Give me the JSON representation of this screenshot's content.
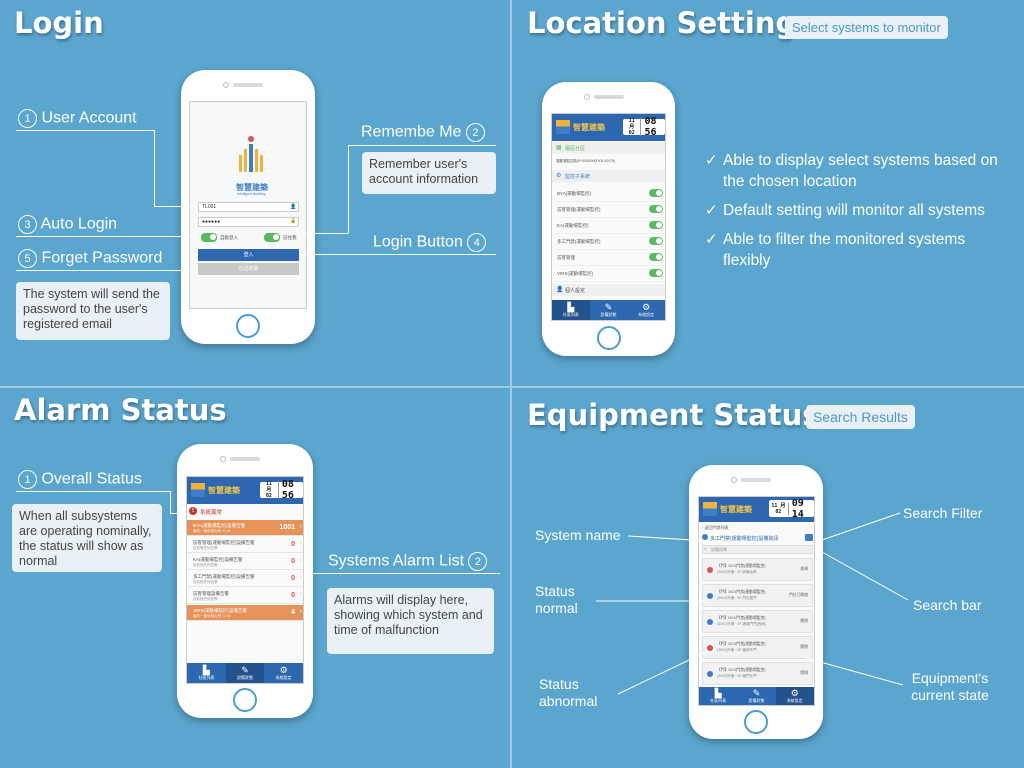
{
  "sections": {
    "login": {
      "title": "Login"
    },
    "location": {
      "title": "Location Settings",
      "tag": "Select systems to monitor"
    },
    "alarm": {
      "title": "Alarm Status"
    },
    "equipment": {
      "title": "Equipment Status",
      "tag": "Search Results"
    }
  },
  "login": {
    "callouts": {
      "user_account": {
        "num": "1",
        "label": "User Account"
      },
      "remember_me": {
        "num": "2",
        "label": "Remembe Me",
        "desc": "Remember user's account information"
      },
      "auto_login": {
        "num": "3",
        "label": "Auto Login"
      },
      "login_button": {
        "num": "4",
        "label": "Login Button"
      },
      "forget_password": {
        "num": "5",
        "label": "Forget Password",
        "desc": "The system will send the password to the user's registered email"
      }
    },
    "screen": {
      "logo_text": "智慧建築",
      "logo_sub": "Intelligent Building",
      "account_value": "TL001",
      "password_value": "●●●●●●",
      "auto_login_label": "自動登入",
      "remember_label": "記住我",
      "login_btn": "登入",
      "forget_btn": "忘記密碼"
    }
  },
  "location": {
    "bullets": [
      "Able to display select systems based on the chosen location",
      "Default setting will monitor all systems",
      "Able to filter the monitored systems flexibly"
    ],
    "screen": {
      "app_name": "智慧建築",
      "date": "11 月 02",
      "time": "08 56",
      "section1": "園區社區",
      "section1_row": "運動場監控區(FH00000000YB-00075)",
      "section2": "監控子系統",
      "systems": [
        "BYA(運動場監控)",
        "訪客管理(運動場監控)",
        "KA(運動場監控)",
        "多工門禁(運動場監控)",
        "訪客管理",
        "VIRS(運動場監控)"
      ],
      "section3": "個人設定",
      "tabs": [
        "社區列表",
        "設備狀態",
        "系統設定"
      ]
    }
  },
  "alarm": {
    "callouts": {
      "overall": {
        "num": "1",
        "label": "Overall Status",
        "desc": "When all subsystems are operating nominally, the status will show as normal"
      },
      "list": {
        "num": "2",
        "label": "Systems Alarm List",
        "desc": "Alarms will display here, showing which system and time of malfunction"
      }
    },
    "screen": {
      "app_name": "智慧建築",
      "date": "11 月 02",
      "time": "08 56",
      "status_text": "系統異常",
      "rows": [
        {
          "name": "BYA(運動場監控)設備告警",
          "sub": "最新一筆設備告警 11:46",
          "count": "1001"
        },
        {
          "name": "訪客管理(運動場監控)設備告警",
          "sub": "目前無任何告警",
          "count": "0"
        },
        {
          "name": "KA(運動場監控)設備告警",
          "sub": "目前無任何告警",
          "count": "0"
        },
        {
          "name": "多工門禁(運動場監控)設備告警",
          "sub": "目前無任何告警",
          "count": "0"
        },
        {
          "name": "訪客管理設備告警",
          "sub": "目前無任何告警",
          "count": "0"
        },
        {
          "name": "VIRS(運動場監控)設備告警",
          "sub": "最新一筆設備告警 11:44",
          "count": "4"
        }
      ],
      "tabs": [
        "社區列表",
        "設備狀態",
        "系統設定"
      ]
    }
  },
  "equipment": {
    "callouts": {
      "system_name": "System name",
      "status_normal": "Status normal",
      "status_abnormal": "Status abnormal",
      "search_filter": "Search Filter",
      "search_bar": "Search bar",
      "current_state": "Equipment's current state"
    },
    "screen": {
      "app_name": "智慧建築",
      "date": "11 月 02",
      "time": "09 14",
      "back": "‹ 返回門禁列表",
      "system": "多工門禁(運動場監控)設備資訊",
      "search_placeholder": "設備搜尋",
      "items": [
        {
          "line1": "【門】DCV門禁(運動場監控)",
          "line2": "(3002)外棟 · 0F-設備倉庫",
          "state": "故障",
          "color": "#d9534f"
        },
        {
          "line1": "【門】DCV門禁(運動場監控)",
          "line2": "(3003)外棟 · 0F-門位置門",
          "state": "門位已開啟",
          "color": "#3c7fc7"
        },
        {
          "line1": "【門】DCV門禁(運動場監控)",
          "line2": "(3001)外棟 · 0F-通道門門(西側)",
          "state": "關閉",
          "color": "#3c7fc7"
        },
        {
          "line1": "【門】DCV門禁(運動場監控)",
          "line2": "(3004)外棟 · 0F-機房外門",
          "state": "關閉",
          "color": "#d9534f"
        },
        {
          "line1": "【門】DCV門禁(運動場監控)",
          "line2": "(3005)外棟 · 0F-機門外門",
          "state": "關閉",
          "color": "#3c7fc7"
        }
      ],
      "tabs": [
        "社區列表",
        "設備狀態",
        "系統設定"
      ]
    }
  }
}
